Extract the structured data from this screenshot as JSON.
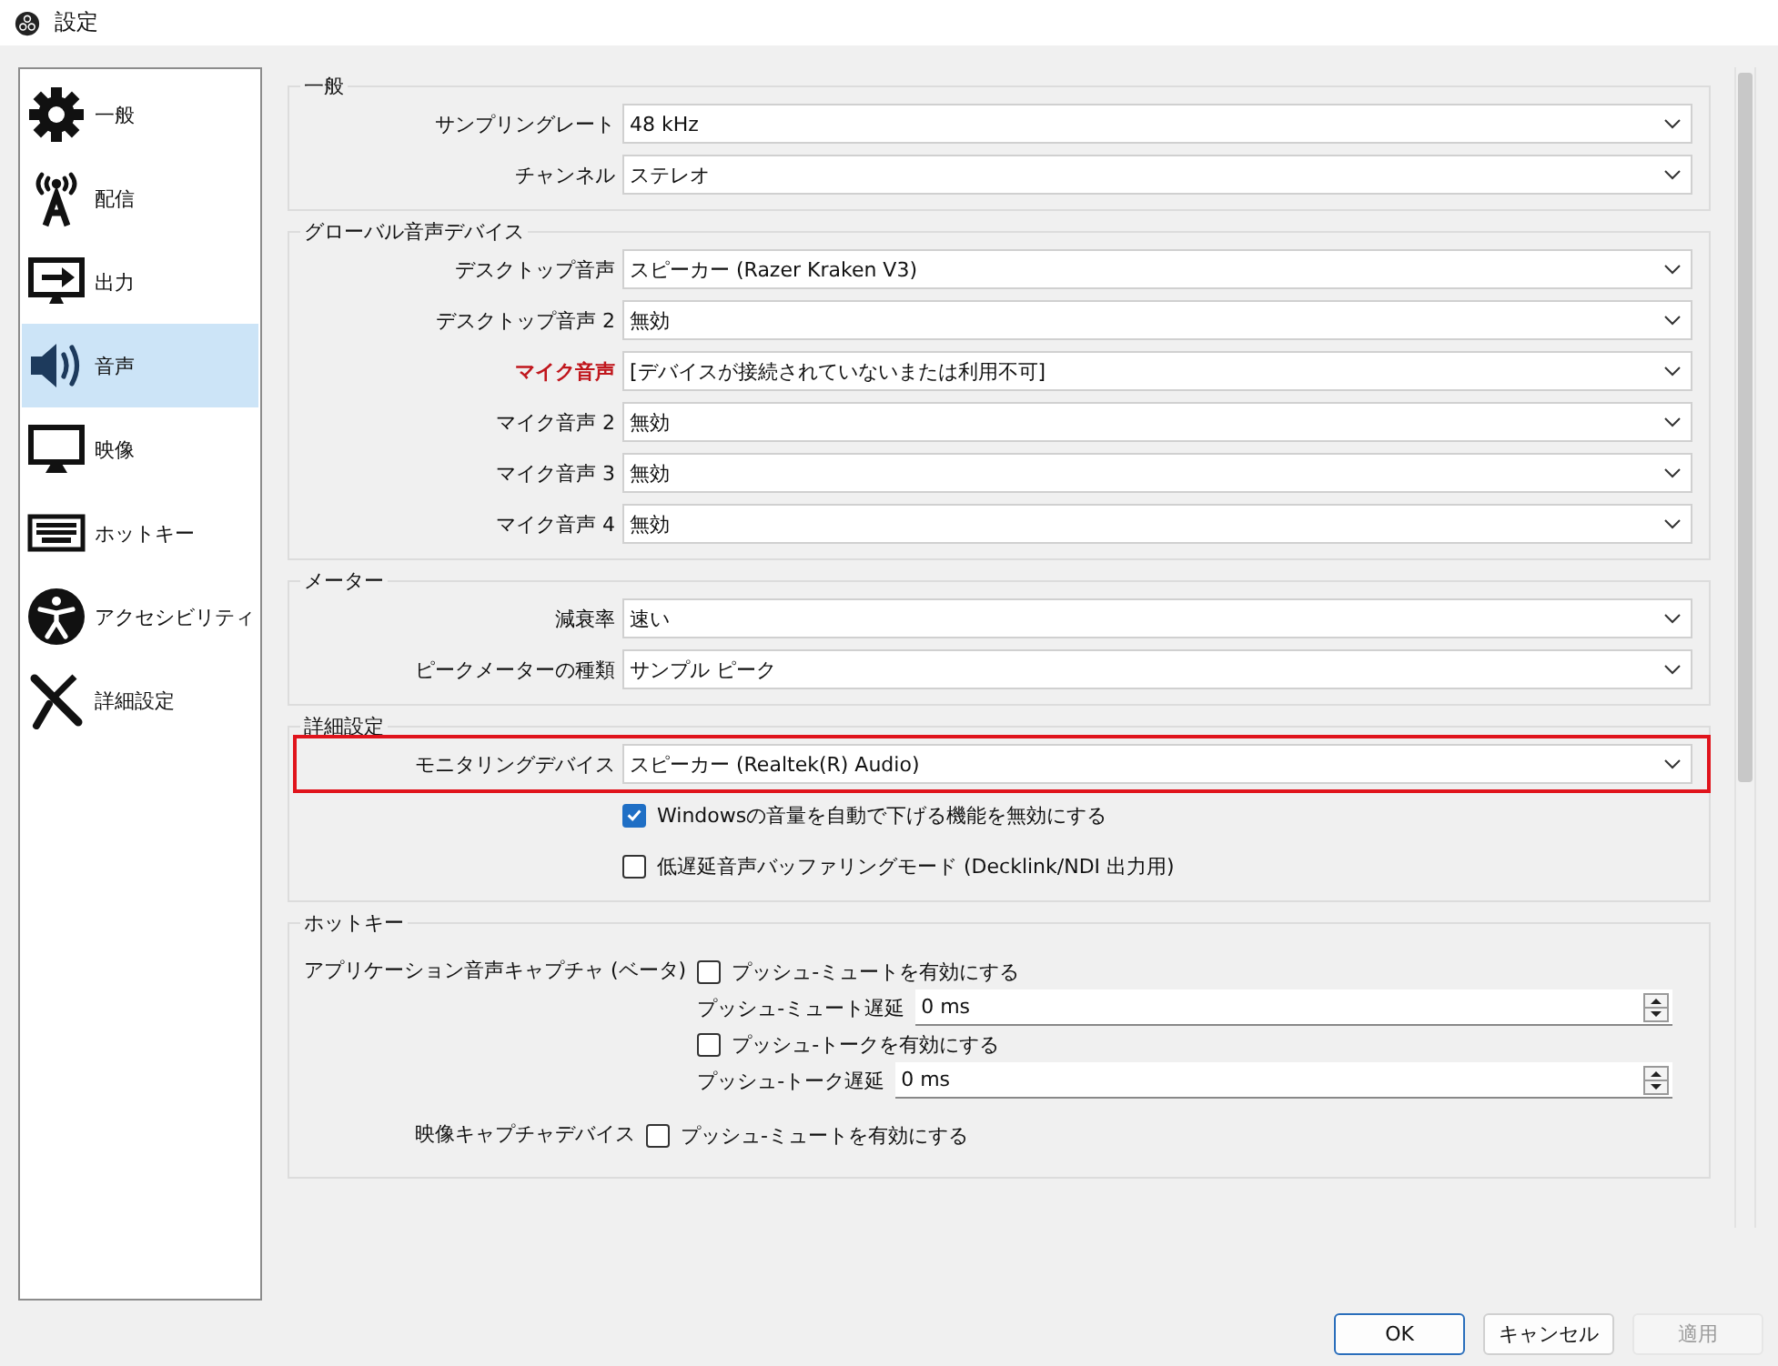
{
  "window": {
    "title": "設定"
  },
  "sidebar": {
    "items": [
      {
        "label": "一般",
        "selected": false
      },
      {
        "label": "配信",
        "selected": false
      },
      {
        "label": "出力",
        "selected": false
      },
      {
        "label": "音声",
        "selected": true
      },
      {
        "label": "映像",
        "selected": false
      },
      {
        "label": "ホットキー",
        "selected": false
      },
      {
        "label": "アクセシビリティ",
        "selected": false
      },
      {
        "label": "詳細設定",
        "selected": false
      }
    ]
  },
  "sections": [
    {
      "title": "一般",
      "rows": [
        {
          "kind": "select",
          "label": "サンプリングレート",
          "value": "48 kHz"
        },
        {
          "kind": "select",
          "label": "チャンネル",
          "value": "ステレオ"
        }
      ]
    },
    {
      "title": "グローバル音声デバイス",
      "rows": [
        {
          "kind": "select",
          "label": "デスクトップ音声",
          "value": "スピーカー (Razer Kraken V3)"
        },
        {
          "kind": "select",
          "label": "デスクトップ音声 2",
          "value": "無効"
        },
        {
          "kind": "select",
          "label": "マイク音声",
          "value": "[デバイスが接続されていないまたは利用不可]",
          "warning": true
        },
        {
          "kind": "select",
          "label": "マイク音声 2",
          "value": "無効"
        },
        {
          "kind": "select",
          "label": "マイク音声 3",
          "value": "無効"
        },
        {
          "kind": "select",
          "label": "マイク音声 4",
          "value": "無効"
        }
      ]
    },
    {
      "title": "メーター",
      "rows": [
        {
          "kind": "select",
          "label": "減衰率",
          "value": "速い"
        },
        {
          "kind": "select",
          "label": "ピークメーターの種類",
          "value": "サンプル ピーク"
        }
      ]
    },
    {
      "title": "詳細設定",
      "rows": [
        {
          "kind": "select",
          "label": "モニタリングデバイス",
          "value": "スピーカー (Realtek(R) Audio)",
          "highlighted": true
        },
        {
          "kind": "checkbox",
          "label": "Windowsの音量を自動で下げる機能を無効にする",
          "checked": true
        },
        {
          "kind": "checkbox",
          "label": "低遅延音声バッファリングモード (Decklink/NDI 出力用)",
          "checked": false
        }
      ]
    },
    {
      "title": "ホットキー",
      "rows": [
        {
          "kind": "hotkey",
          "label": "アプリケーション音声キャプチャ (ベータ)",
          "controls": [
            {
              "kind": "checkbox",
              "label": "プッシュ-ミュートを有効にする",
              "checked": false
            },
            {
              "kind": "spin",
              "label": "プッシュ-ミュート遅延",
              "value": "0 ms"
            },
            {
              "kind": "checkbox",
              "label": "プッシュ-トークを有効にする",
              "checked": false
            },
            {
              "kind": "spin",
              "label": "プッシュ-トーク遅延",
              "value": "0 ms"
            }
          ]
        },
        {
          "kind": "hotkey",
          "label": "映像キャプチャデバイス",
          "controls": [
            {
              "kind": "checkbox",
              "label": "プッシュ-ミュートを有効にする",
              "checked": false
            }
          ]
        }
      ]
    }
  ],
  "buttons": [
    {
      "label": "OK",
      "default": true,
      "disabled": false
    },
    {
      "label": "キャンセル",
      "default": false,
      "disabled": false
    },
    {
      "label": "適用",
      "default": false,
      "disabled": true
    }
  ]
}
